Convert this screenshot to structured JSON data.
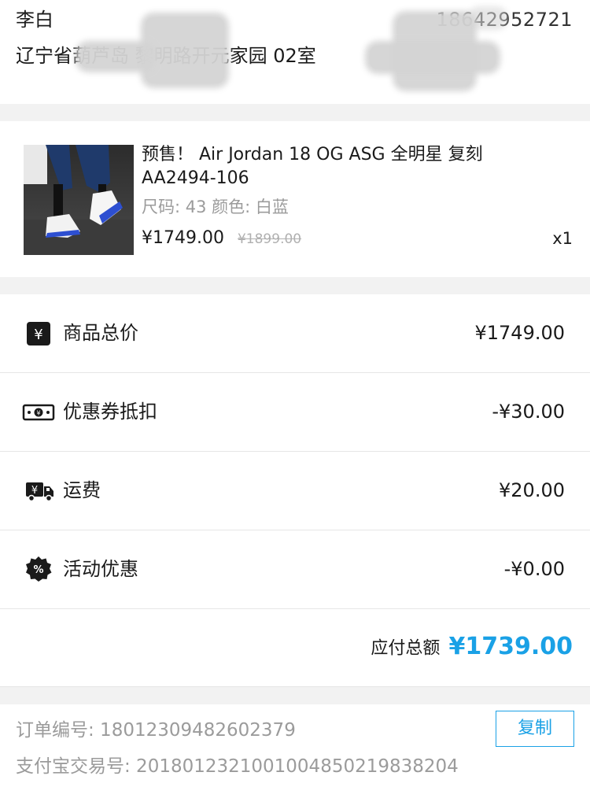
{
  "address": {
    "name": "李白",
    "phone": "18642952721",
    "line": "辽宁省葫芦岛                    黎明路开元家园                      02室"
  },
  "product": {
    "title": "预售！ Air Jordan 18 OG ASG 全明星 复刻 AA2494-106",
    "attrs": "尺码: 43  颜色: 白蓝",
    "price": "¥1749.00",
    "original_price": "¥1899.00",
    "quantity": "x1"
  },
  "summary": {
    "rows": [
      {
        "label": "商品总价",
        "value": "¥1749.00",
        "icon": "yen-icon"
      },
      {
        "label": "优惠券抵扣",
        "value": "-¥30.00",
        "icon": "coupon-icon"
      },
      {
        "label": "运费",
        "value": "¥20.00",
        "icon": "delivery-truck-icon"
      },
      {
        "label": "活动优惠",
        "value": "-¥0.00",
        "icon": "discount-percent-icon"
      }
    ],
    "total_label": "应付总额",
    "total_value": "¥1739.00"
  },
  "order": {
    "order_no": "订单编号: 18012309482602379",
    "alipay_no": "支付宝交易号: 2018012321001004850219838204",
    "copy_label": "复制"
  },
  "colors": {
    "accent": "#1aa1e6",
    "muted_text": "#9b9b9b",
    "separator": "#f2f2f2"
  }
}
